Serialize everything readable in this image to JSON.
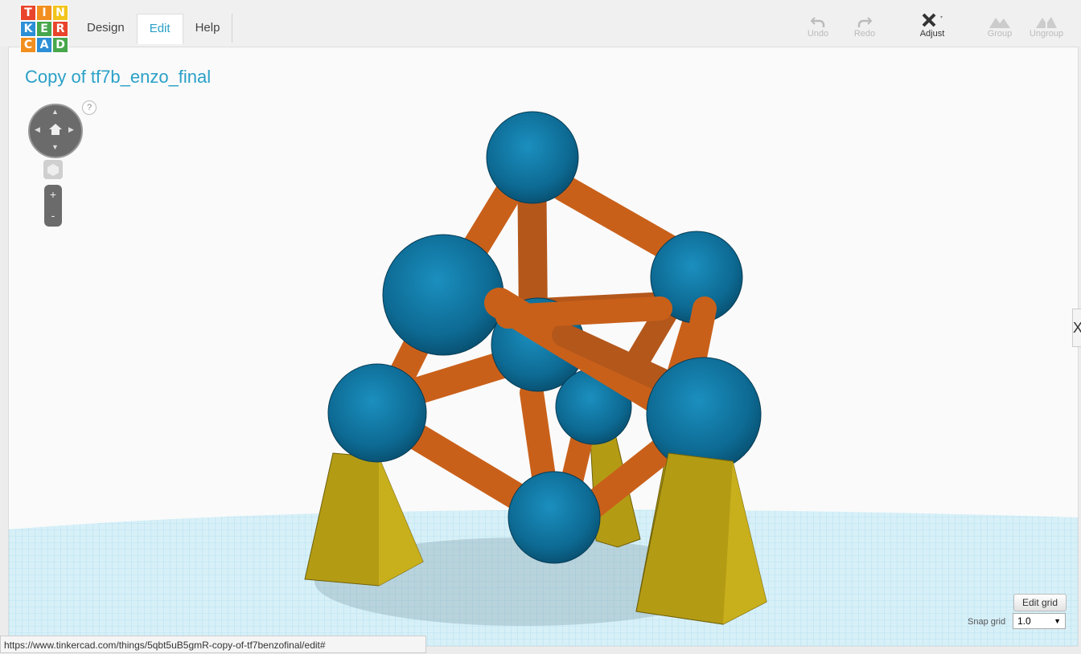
{
  "logo": {
    "letters": [
      "T",
      "I",
      "N",
      "K",
      "E",
      "R",
      "C",
      "A",
      "D"
    ],
    "colors": [
      "#e8452c",
      "#f28f1f",
      "#f2c41c",
      "#2d8fd6",
      "#48a74c",
      "#e8452c",
      "#f28f1f",
      "#2d8fd6",
      "#48a74c"
    ]
  },
  "menu": {
    "design": "Design",
    "edit": "Edit",
    "help": "Help"
  },
  "toolbar": {
    "undo": "Undo",
    "redo": "Redo",
    "adjust": "Adjust",
    "group": "Group",
    "ungroup": "Ungroup"
  },
  "document": {
    "title": "Copy of tf7b_enzo_final"
  },
  "view_controls": {
    "help_glyph": "?",
    "zoom_in": "+",
    "zoom_out": "-"
  },
  "side_tab": {
    "label": "X"
  },
  "grid": {
    "edit_label": "Edit grid",
    "snap_label": "Snap grid",
    "snap_value": "1.0"
  },
  "status_url": "https://www.tinkercad.com/things/5qbt5uB5gmR-copy-of-tf7benzofinal/edit#",
  "colors": {
    "accent": "#2aa0c7",
    "sphere": "#0e6f98",
    "rod": "#c9601a",
    "base": "#b39c14",
    "grid": "#9fd6ea"
  }
}
